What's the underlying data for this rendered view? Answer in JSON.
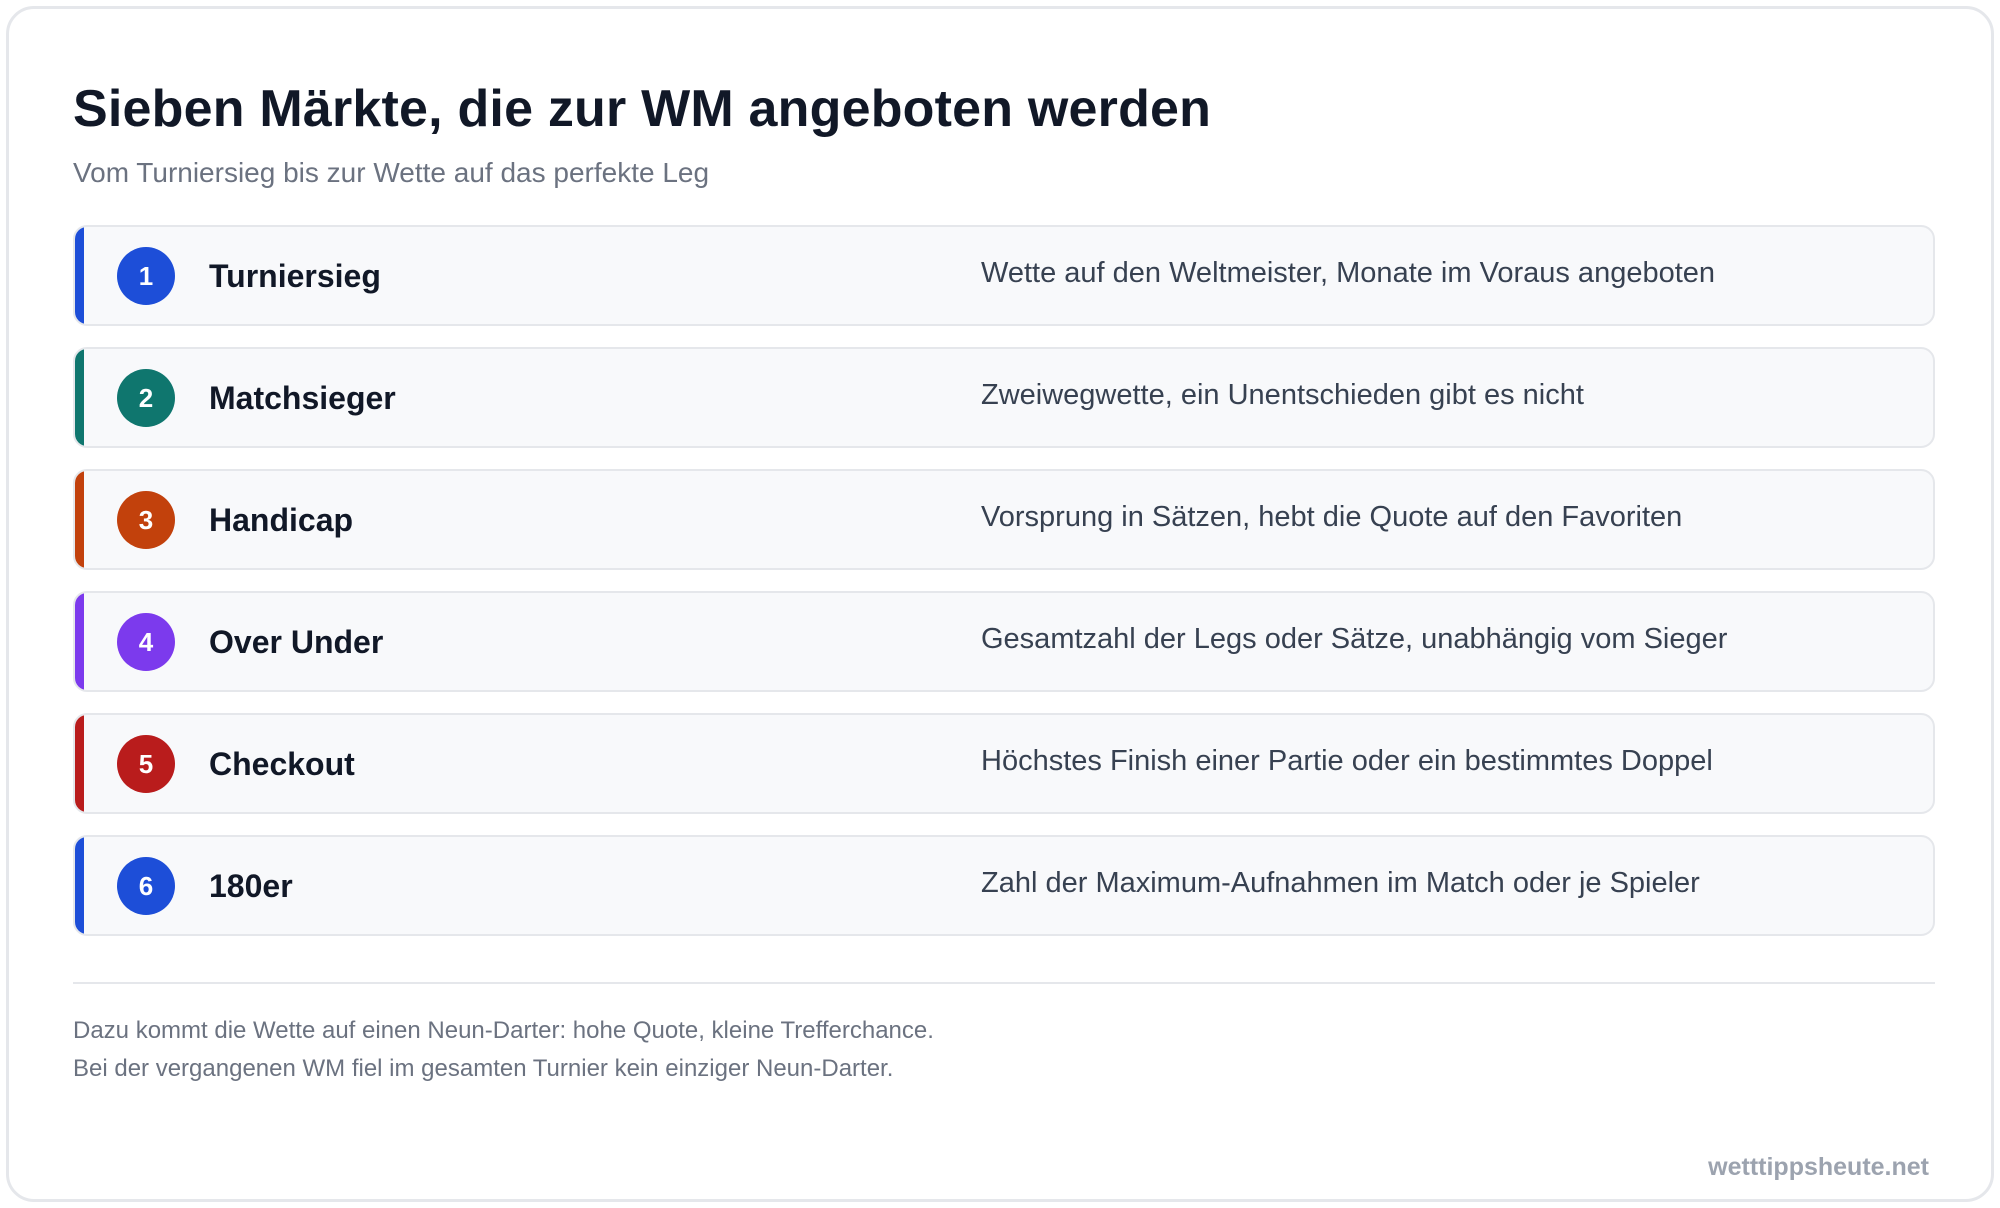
{
  "header": {
    "title": "Sieben Märkte, die zur WM angeboten werden",
    "subtitle": "Vom Turniersieg bis zur Wette auf das perfekte Leg"
  },
  "markets": [
    {
      "number": "1",
      "name": "Turniersieg",
      "description": "Wette auf den Weltmeister, Monate im Voraus angeboten",
      "color": "#1d4ed8"
    },
    {
      "number": "2",
      "name": "Matchsieger",
      "description": "Zweiwegwette, ein Unentschieden gibt es nicht",
      "color": "#0f766e"
    },
    {
      "number": "3",
      "name": "Handicap",
      "description": "Vorsprung in Sätzen, hebt die Quote auf den Favoriten",
      "color": "#c2410c"
    },
    {
      "number": "4",
      "name": "Over Under",
      "description": "Gesamtzahl der Legs oder Sätze, unabhängig vom Sieger",
      "color": "#7c3aed"
    },
    {
      "number": "5",
      "name": "Checkout",
      "description": "Höchstes Finish einer Partie oder ein bestimmtes Doppel",
      "color": "#b91c1c"
    },
    {
      "number": "6",
      "name": "180er",
      "description": "Zahl der Maximum-Aufnahmen im Match oder je Spieler",
      "color": "#1d4ed8"
    }
  ],
  "footer": {
    "note_line1": "Dazu kommt die Wette auf einen Neun-Darter: hohe Quote, kleine Trefferchance.",
    "note_line2": "Bei der vergangenen WM fiel im gesamten Turnier kein einziger Neun-Darter.",
    "brand": "wetttippsheute.net"
  }
}
